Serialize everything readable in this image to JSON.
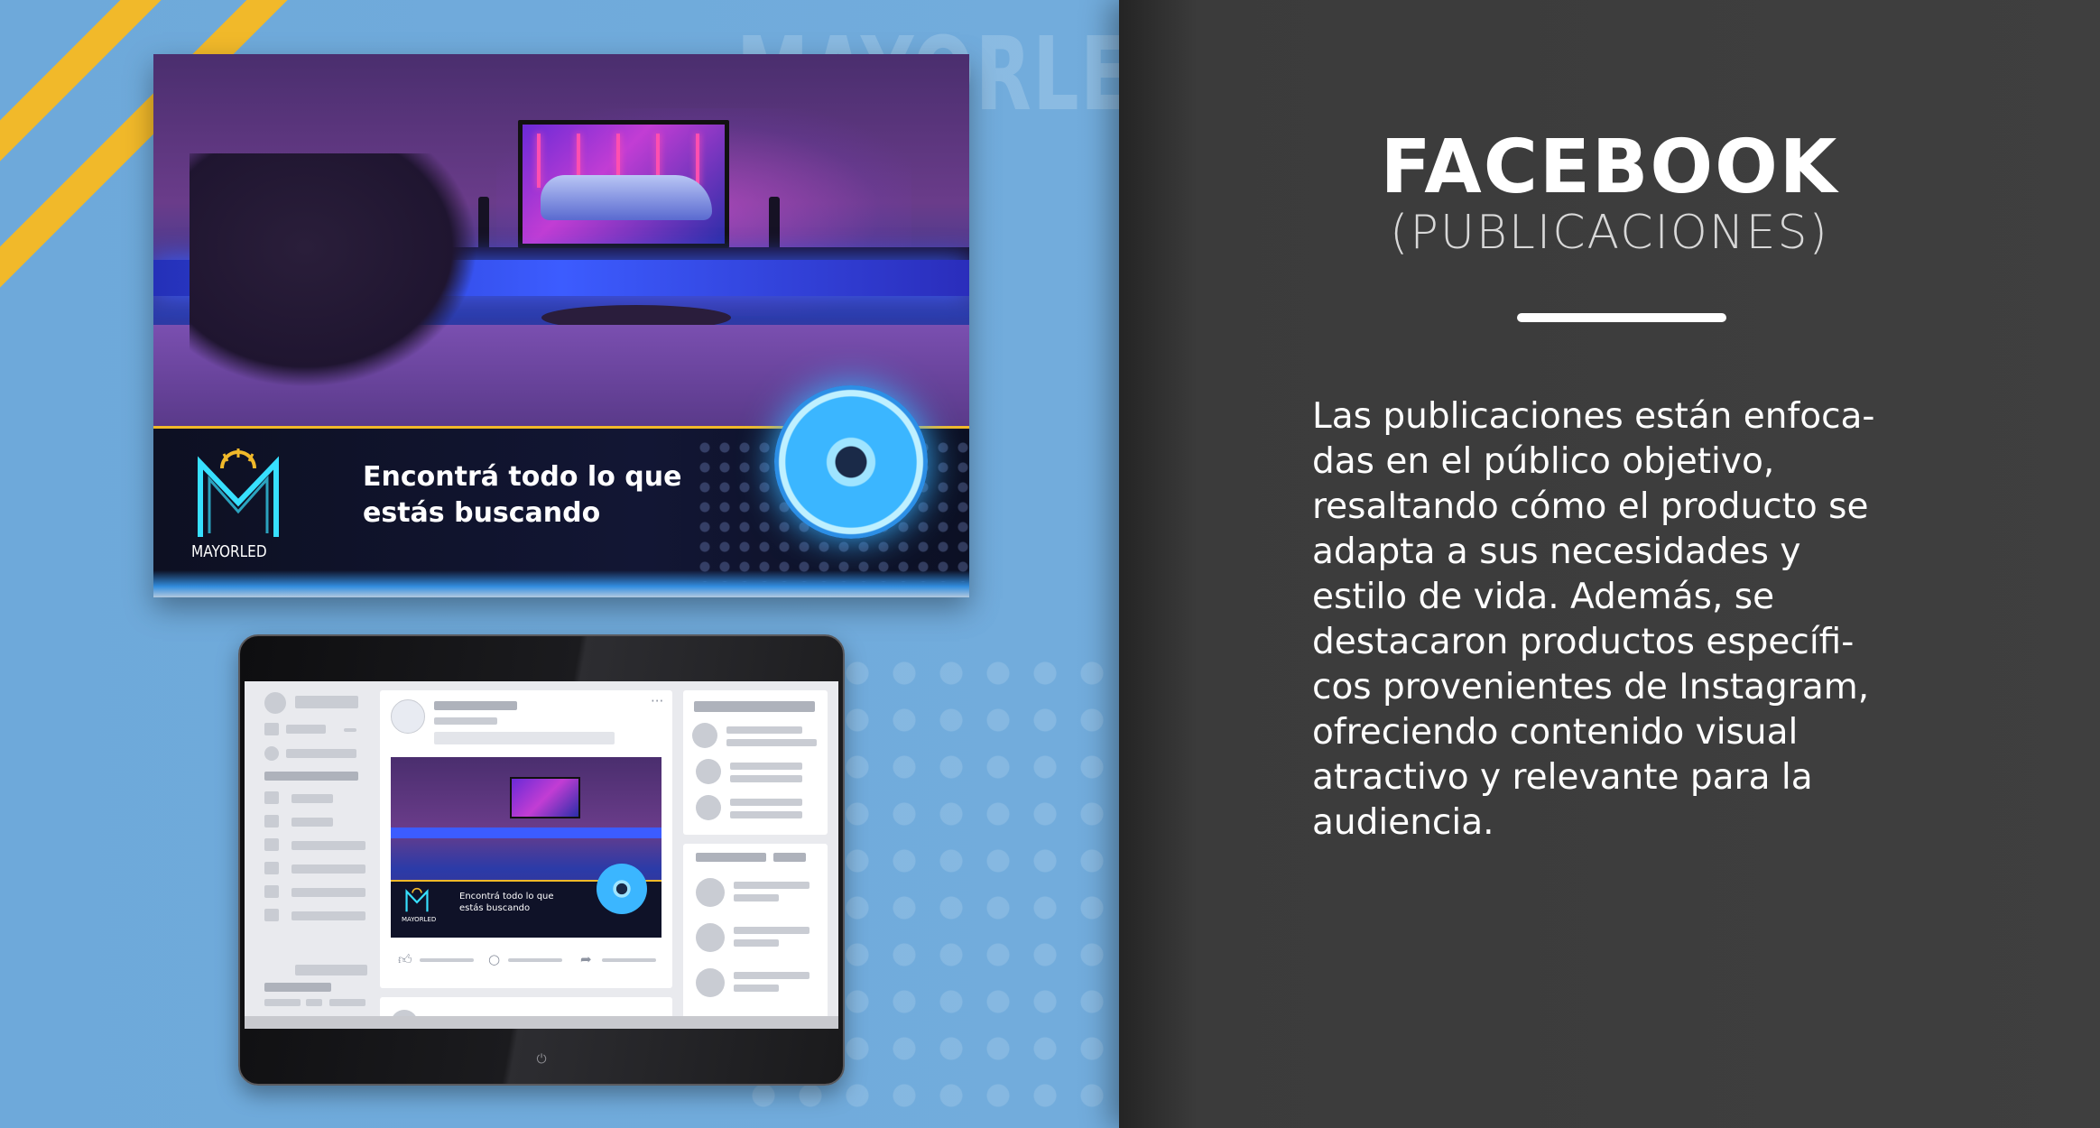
{
  "brand": {
    "watermark": "MAYORLED",
    "logo_text": "MAYORLED",
    "accent_yellow": "#f1b92a",
    "panel_blue": "#6ea9da",
    "panel_dark": "#3f3f3f"
  },
  "ad": {
    "tagline_line1": "Encontrá todo lo que",
    "tagline_line2": "estás buscando"
  },
  "tablet_post": {
    "tagline_line1": "Encontrá todo lo que",
    "tagline_line2": "estás buscando",
    "logo_text": "MAYORLED",
    "more_icon": "more-dots-icon",
    "actions": [
      "like-icon",
      "comment-icon",
      "share-icon"
    ]
  },
  "right": {
    "title": "FACEBOOK",
    "subtitle": "(PUBLICACIONES)",
    "description_lines": [
      "Las publicaciones están enfoca-",
      "das en el público objetivo,",
      "resaltando cómo el producto se",
      "adapta a sus necesidades y",
      "estilo de vida. Además, se",
      "destacaron productos específi-",
      "cos provenientes de Instagram,",
      "ofreciendo contenido visual",
      "atractivo y relevante para la",
      "audiencia."
    ]
  }
}
